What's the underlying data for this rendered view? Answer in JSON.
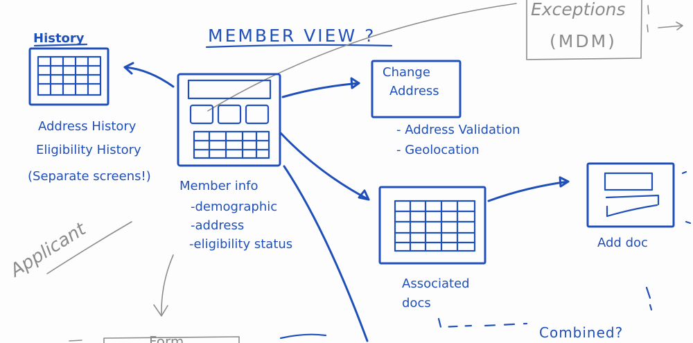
{
  "title": "MEMBER VIEW ?",
  "exceptions": {
    "line1": "Exceptions",
    "line2": "(MDM)"
  },
  "history": {
    "label": "History",
    "notes": [
      "Address History",
      "Eligibility History",
      "(Separate screens!)"
    ]
  },
  "member": {
    "label": "Member info",
    "bullets": [
      "-demographic",
      "-address",
      "-eligibility status"
    ]
  },
  "change_address": {
    "line1": "Change",
    "line2": "Address",
    "bullets": [
      "- Address Validation",
      "- Geolocation"
    ]
  },
  "associated_docs": {
    "line1": "Associated",
    "line2": "docs"
  },
  "add_doc": {
    "label": "Add doc"
  },
  "combined": {
    "label": "Combined?"
  },
  "applicant": {
    "label": "Applicant"
  },
  "bottom_form": {
    "label": "Form"
  }
}
